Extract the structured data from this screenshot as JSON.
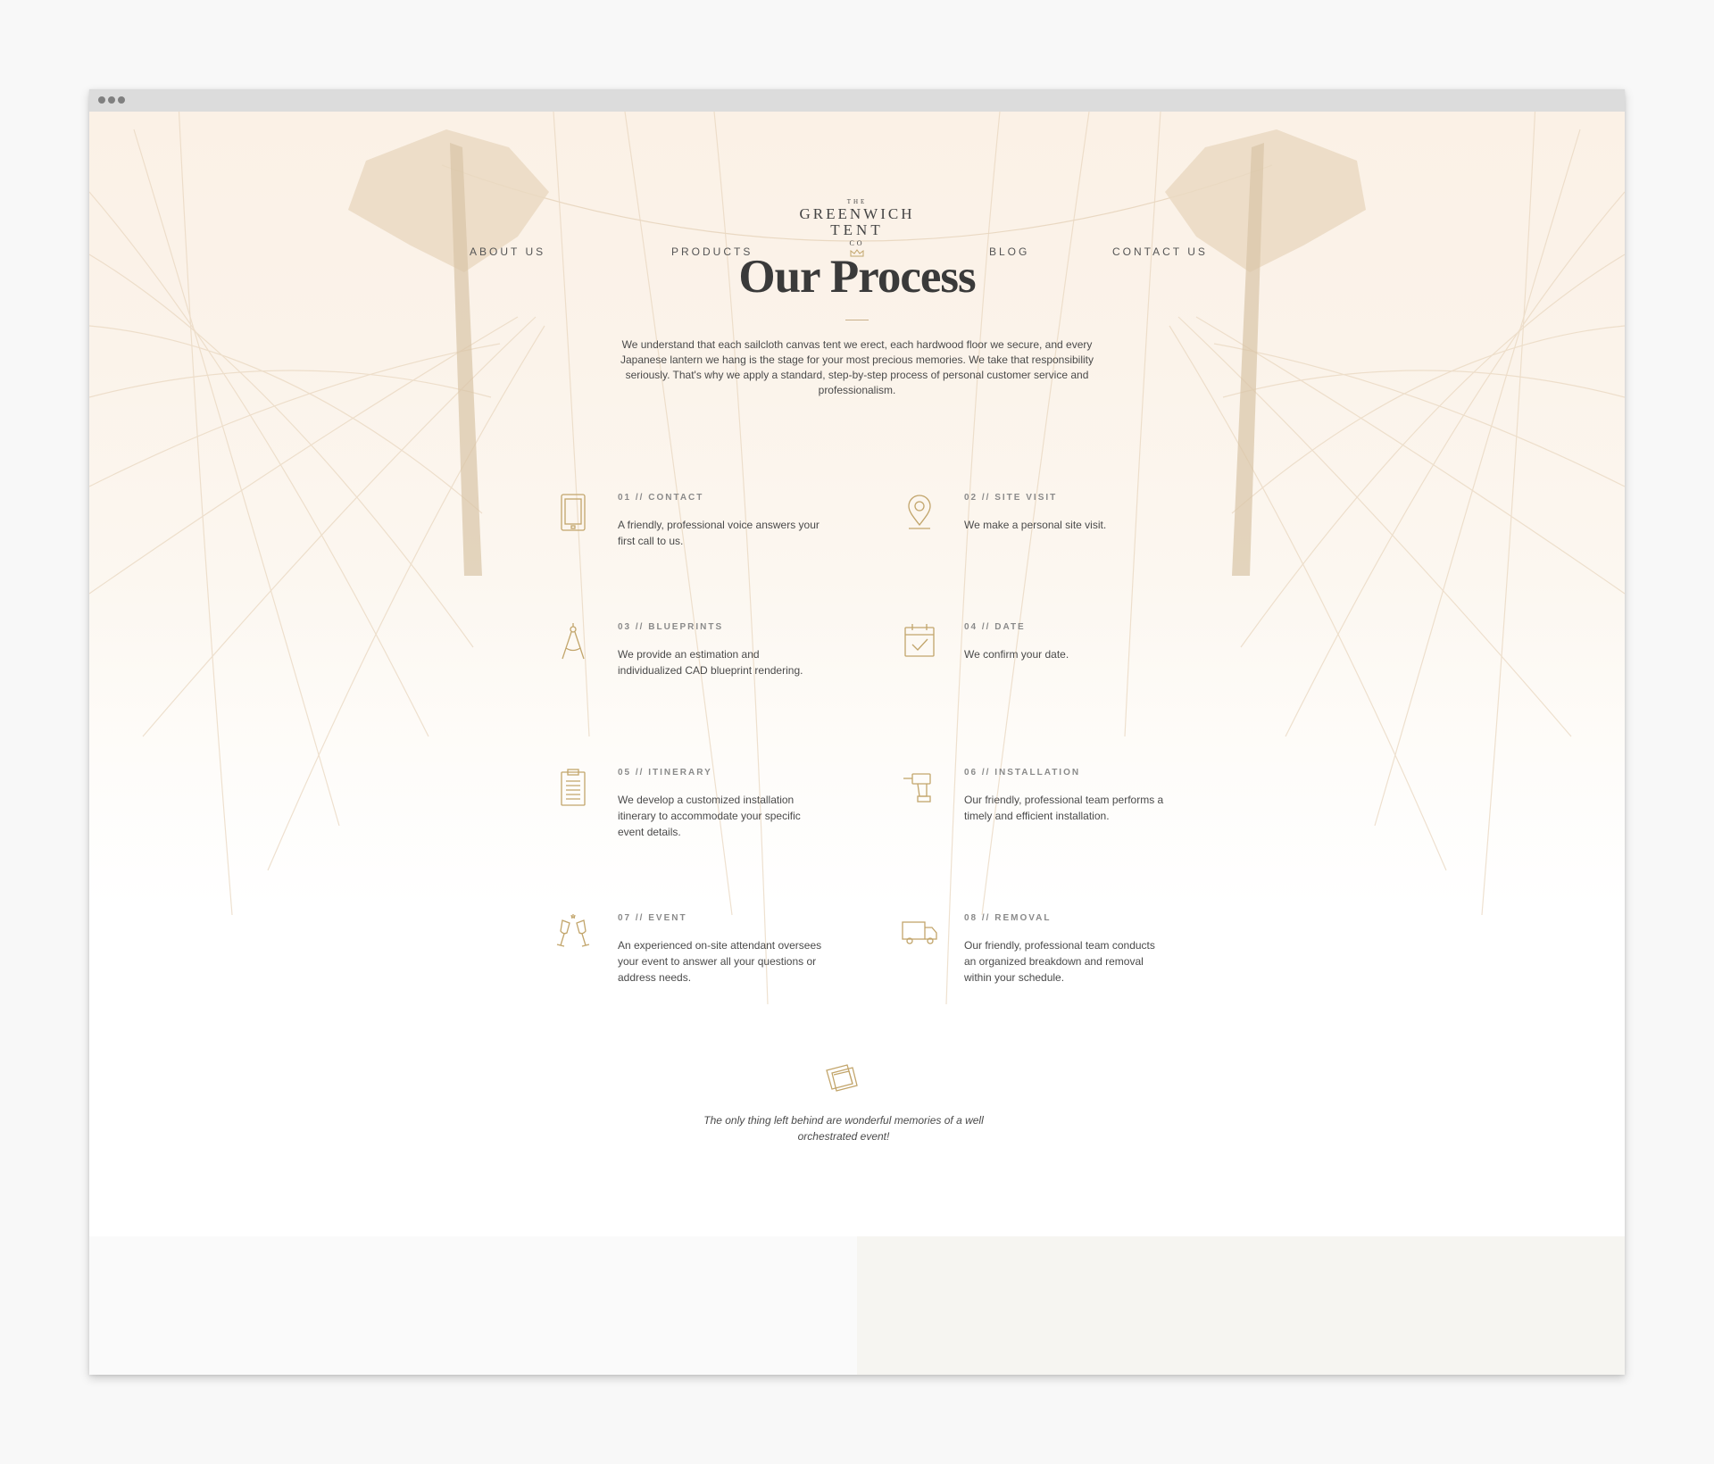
{
  "nav": {
    "items": [
      "ABOUT US",
      "PRODUCTS",
      "BLOG",
      "CONTACT US"
    ]
  },
  "logo": {
    "the": "THE",
    "line1": "GREENWICH",
    "line2": "TENT",
    "co": "CO"
  },
  "page": {
    "title": "Our Process",
    "intro": "We understand that each sailcloth canvas tent we erect, each hardwood floor we secure, and every Japanese lantern we hang is the stage for your most precious memories. We take that responsibility seriously. That's why we apply a standard, step-by-step process of personal customer service and professionalism."
  },
  "steps": [
    {
      "heading": "01 // CONTACT",
      "text": "A friendly, professional voice answers your first call to us.",
      "icon": "tablet-icon"
    },
    {
      "heading": "02 // SITE VISIT",
      "text": "We make a personal site visit.",
      "icon": "map-pin-icon"
    },
    {
      "heading": "03 // BLUEPRINTS",
      "text": "We provide an estimation and individualized CAD blueprint rendering.",
      "icon": "compass-icon"
    },
    {
      "heading": "04 // DATE",
      "text": "We confirm your date.",
      "icon": "calendar-check-icon"
    },
    {
      "heading": "05 // ITINERARY",
      "text": "We develop a customized installation itinerary to accommodate your specific event details.",
      "icon": "clipboard-icon"
    },
    {
      "heading": "06 // INSTALLATION",
      "text": "Our friendly, professional team performs a timely and efficient installation.",
      "icon": "drill-icon"
    },
    {
      "heading": "07 // EVENT",
      "text": "An experienced on-site attendant oversees your event to answer all your questions or address needs.",
      "icon": "champagne-glasses-icon"
    },
    {
      "heading": "08 // REMOVAL",
      "text": "Our friendly, professional team conducts an organized breakdown and removal within your schedule.",
      "icon": "truck-icon"
    }
  ],
  "closing": {
    "text": "The only thing left behind are wonderful memories of a well orchestrated event!",
    "icon": "photos-icon"
  },
  "colors": {
    "accent": "#c2a56b",
    "heading": "#3a3a3a",
    "body": "#4a4a4a",
    "hero_tint": "#fbf1e6"
  }
}
